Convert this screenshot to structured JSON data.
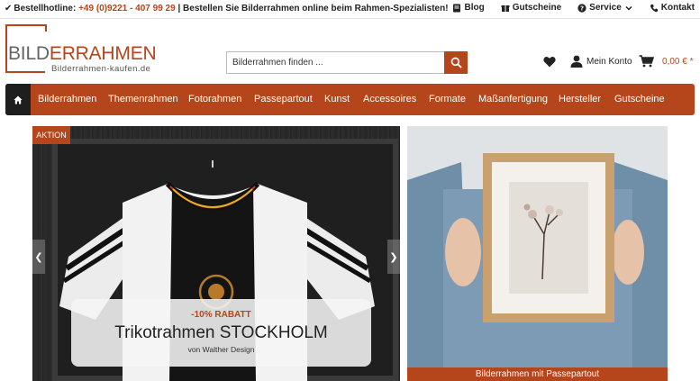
{
  "topbar": {
    "hotline_label": "Bestellhotline:",
    "hotline_number": "+49 (0)9221 - 407 99 29",
    "hotline_text": "| Bestellen Sie Bilderrahmen online beim Rahmen-Spezialisten!",
    "links": {
      "blog": "Blog",
      "gutscheine": "Gutscheine",
      "service": "Service",
      "kontakt": "Kontakt"
    }
  },
  "logo": {
    "word_part1": "BILD",
    "word_part2": "ERRAHMEN",
    "subtitle": "Bilderrahmen-kaufen.de"
  },
  "search": {
    "placeholder": "Bilderrahmen finden ..."
  },
  "header": {
    "account_label": "Mein Konto",
    "cart_total": "0,00 € *"
  },
  "nav": {
    "items": [
      "Bilderrahmen",
      "Themenrahmen",
      "Fotorahmen",
      "Passepartout",
      "Kunst",
      "Accessoires",
      "Formate",
      "Maßanfertigung",
      "Hersteller",
      "Gutscheine"
    ]
  },
  "slider": {
    "badge": "AKTION",
    "promo_discount": "-10% RABATT",
    "promo_title": "Trikotrahmen STOCKHOLM",
    "promo_by": "von Walther Design"
  },
  "banner": {
    "caption": "Bilderrahmen mit Passepartout"
  },
  "colors": {
    "brand": "#b5451b",
    "nav_home": "#1e1e1e"
  }
}
